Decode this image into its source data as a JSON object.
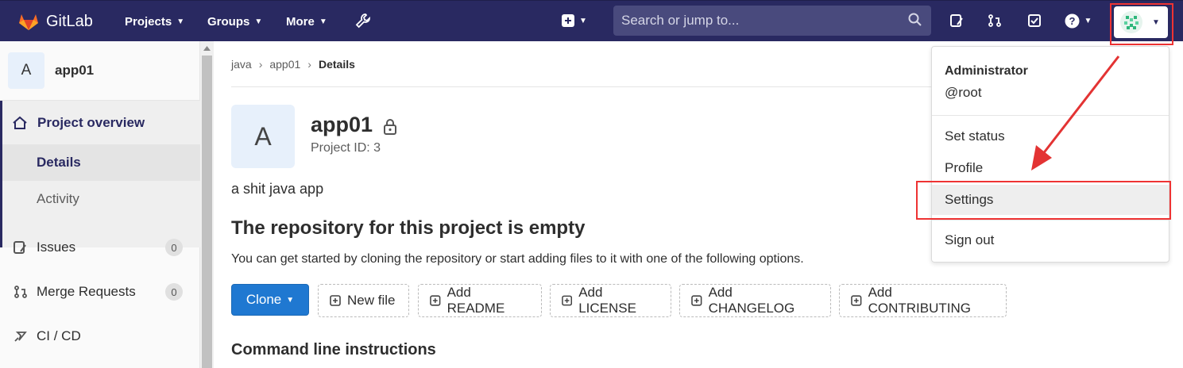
{
  "navbar": {
    "brand": "GitLab",
    "links": [
      "Projects",
      "Groups",
      "More"
    ],
    "search_placeholder": "Search or jump to...",
    "bg_color": "#292961"
  },
  "sidebar": {
    "project_initial": "A",
    "project_name": "app01",
    "overview_label": "Project overview",
    "details_label": "Details",
    "activity_label": "Activity",
    "issues_label": "Issues",
    "issues_count": "0",
    "mr_label": "Merge Requests",
    "mr_count": "0",
    "cicd_label": "CI / CD"
  },
  "breadcrumb": [
    "java",
    "app01",
    "Details"
  ],
  "project": {
    "initial": "A",
    "title": "app01",
    "id_text": "Project ID: 3",
    "description": "a shit java app"
  },
  "empty_repo": {
    "heading": "The repository for this project is empty",
    "hint": "You can get started by cloning the repository or start adding files to it with one of the following options.",
    "clone_label": "Clone",
    "buttons": [
      "New file",
      "Add README",
      "Add LICENSE",
      "Add CHANGELOG",
      "Add CONTRIBUTING"
    ],
    "cli_heading": "Command line instructions"
  },
  "user_menu": {
    "name": "Administrator",
    "username": "@root",
    "items": [
      "Set status",
      "Profile",
      "Settings",
      "Sign out"
    ],
    "highlight_color": "#e33333"
  }
}
